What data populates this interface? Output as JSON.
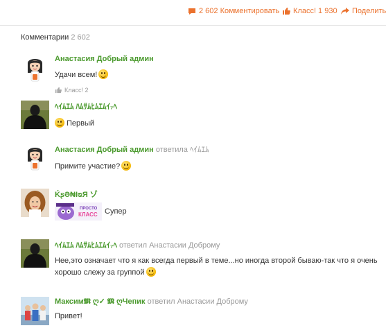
{
  "topbar": {
    "comments": "2 602 Комментировать",
    "class_label": "Класс! 1 930",
    "share": "Поделиться"
  },
  "comments_header": {
    "label": "Комментарии",
    "count": "2 602"
  },
  "comments": [
    {
      "author": "Анастасия Добрый админ",
      "meta": "",
      "text": "Удачи всем!",
      "emoji": "smile",
      "like": "Класс! 2"
    },
    {
      "author": "ﾍｲﾑｴﾑ ﾊﾑｻﾑﾋﾑｴﾑｲ₇ﾍ",
      "meta": "",
      "text": "Первый",
      "emoji_before": "smile"
    },
    {
      "author": "Анастасия Добрый админ",
      "meta": "ответила ﾍｲﾑｴﾑ",
      "text": "Примите участие?",
      "emoji": "smile"
    },
    {
      "author": "ḰʂƏ₦ӀᴓЯ ゾ",
      "meta": "",
      "text": "Супер",
      "sticker": "ну ваааще ПРОСТО КЛАСС"
    },
    {
      "author": "ﾍｲﾑｴﾑ ﾊﾑｻﾑﾋﾑｴﾑｲ₇ﾍ",
      "meta": "ответил Анастасии Доброму",
      "text": "Нее,это означает что я как всегда первый в теме...но иногда второй бываю-так что я очень хорошо слежу за группой",
      "emoji": "smile"
    },
    {
      "author": "Максим𝕸 ღ✓ 𝕸 ღЧепик",
      "meta": "ответил Анастасии Доброму",
      "text": "Привет!"
    }
  ],
  "colors": {
    "accent": "#eb722e",
    "author": "#4b9a2e",
    "muted": "#999999"
  }
}
